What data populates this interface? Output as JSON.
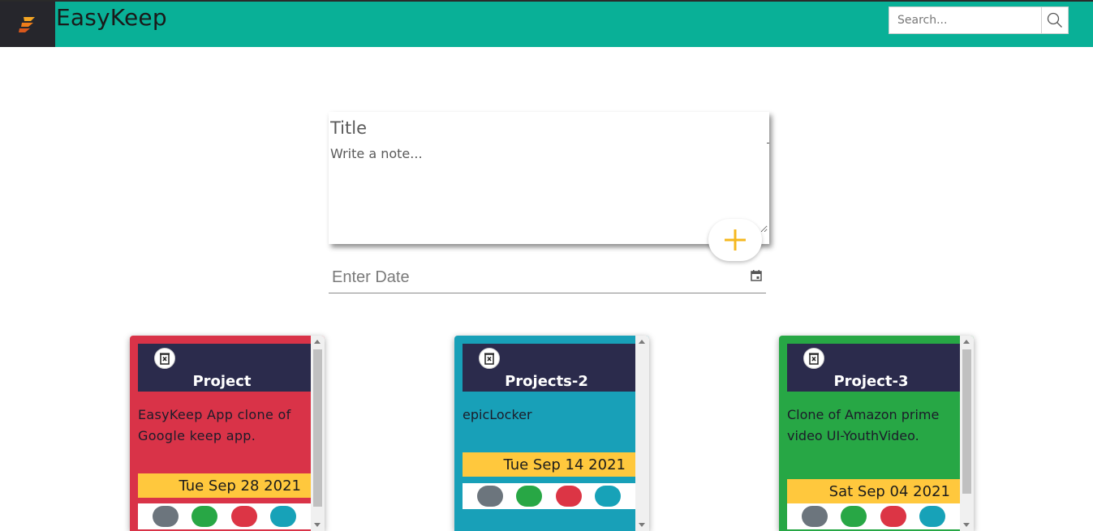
{
  "app": {
    "title": "EasyKeep",
    "logo_icon": "flame-logo-icon"
  },
  "search": {
    "placeholder": "Search...",
    "icon": "search-icon"
  },
  "creator": {
    "title_placeholder": "Title",
    "note_placeholder": "Write a note...",
    "add_icon": "plus-icon",
    "add_color": "#f5b820",
    "date_placeholder": "Enter Date",
    "date_icon": "calendar-icon"
  },
  "notes": [
    {
      "title": "Project",
      "body": "EasyKeep App clone of Google keep app.",
      "date": "Tue Sep 28 2021",
      "color": "#d93348"
    },
    {
      "title": "Projects-2",
      "body": "epicLocker",
      "date": "Tue Sep 14 2021",
      "color": "#18a0b8"
    },
    {
      "title": "Project-3",
      "body": "Clone of Amazon prime video UI-YouthVideo.",
      "date": "Sat Sep 04 2021",
      "color": "#27a745"
    }
  ],
  "swatches": [
    "#6c757d",
    "#28a745",
    "#dc3545",
    "#17a2b8"
  ],
  "colors": {
    "header": "#09b097",
    "card_header": "#2b2b4c",
    "date_badge": "#ffc83d"
  }
}
